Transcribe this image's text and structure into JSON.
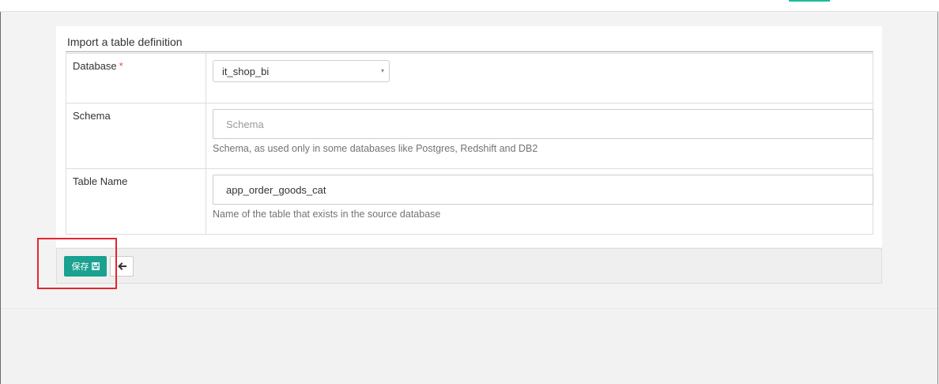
{
  "form": {
    "title": "Import a table definition",
    "database": {
      "label": "Database",
      "required_marker": "*",
      "value": "it_shop_bi",
      "caret": "▾"
    },
    "schema": {
      "label": "Schema",
      "placeholder": "Schema",
      "help": "Schema, as used only in some databases like Postgres, Redshift and DB2"
    },
    "table_name": {
      "label": "Table Name",
      "value": "app_order_goods_cat",
      "help": "Name of the table that exists in the source database"
    }
  },
  "footer": {
    "save_label": "保存",
    "save_icon": "floppy-disk-icon",
    "back_icon": "arrow-left-icon"
  },
  "colors": {
    "accent": "#1aa190",
    "required": "#e74c3c",
    "annotation": "#e3262e"
  }
}
